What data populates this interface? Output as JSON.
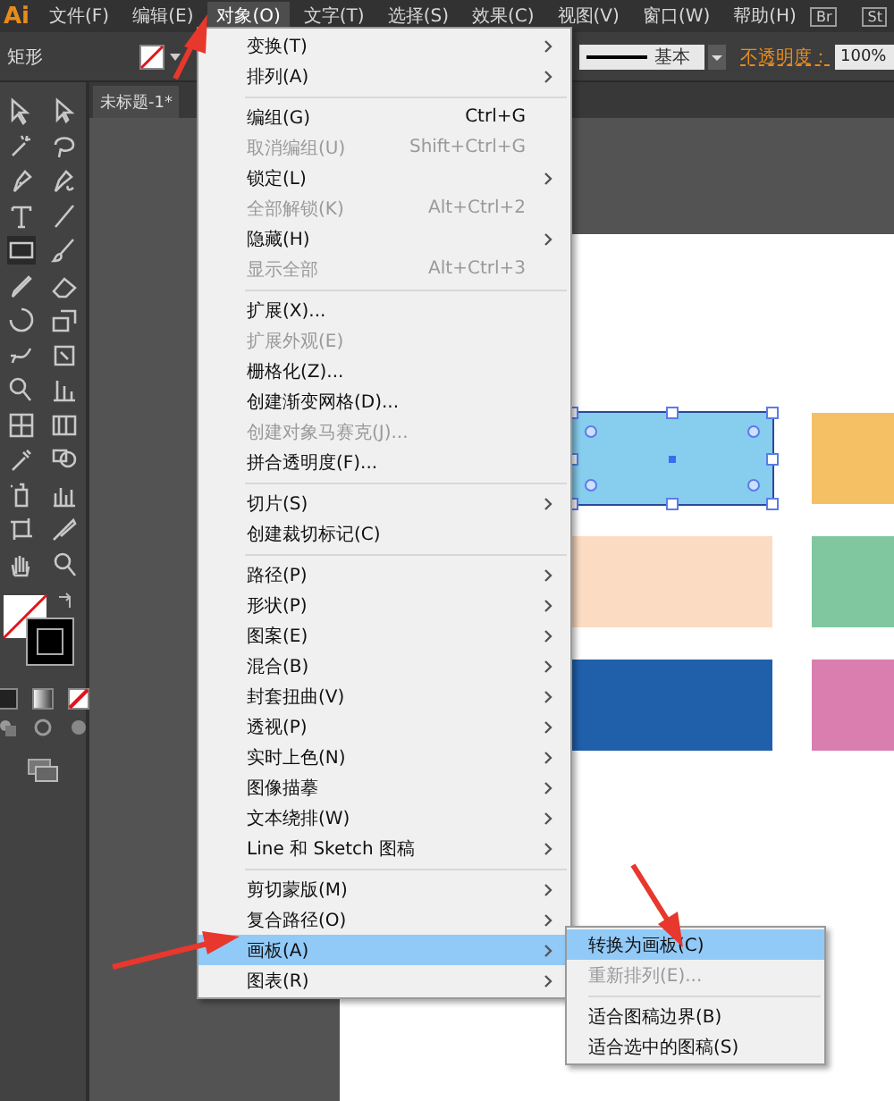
{
  "app_logo": "Ai",
  "menu_bar": [
    {
      "label": "文件(F)",
      "selected": false
    },
    {
      "label": "编辑(E)",
      "selected": false
    },
    {
      "label": "对象(O)",
      "selected": true
    },
    {
      "label": "文字(T)",
      "selected": false
    },
    {
      "label": "选择(S)",
      "selected": false
    },
    {
      "label": "效果(C)",
      "selected": false
    },
    {
      "label": "视图(V)",
      "selected": false
    },
    {
      "label": "窗口(W)",
      "selected": false
    },
    {
      "label": "帮助(H)",
      "selected": false
    }
  ],
  "bridge_buttons": [
    "Br",
    "St"
  ],
  "control_bar": {
    "tool_name": "矩形",
    "stroke_style": "基本",
    "opacity_label": "不透明度：",
    "opacity_value": "100%"
  },
  "document_tab": "未标题-1*",
  "artboard_shapes": [
    {
      "color": "#86cdee",
      "selected": true
    },
    {
      "color": "#f5c063",
      "selected": false
    },
    {
      "color": "#fbdcc3",
      "selected": false
    },
    {
      "color": "#80c7a0",
      "selected": false
    },
    {
      "color": "#2060ab",
      "selected": false
    },
    {
      "color": "#d97eae",
      "selected": false
    }
  ],
  "object_menu": [
    {
      "kind": "item",
      "label": "变换(T)",
      "submenu": true,
      "disabled": false,
      "selected": false
    },
    {
      "kind": "item",
      "label": "排列(A)",
      "submenu": true,
      "disabled": false,
      "selected": false
    },
    {
      "kind": "separator"
    },
    {
      "kind": "item",
      "label": "编组(G)",
      "shortcut": "Ctrl+G",
      "submenu": false,
      "disabled": false,
      "selected": false
    },
    {
      "kind": "item",
      "label": "取消编组(U)",
      "shortcut": "Shift+Ctrl+G",
      "submenu": false,
      "disabled": true,
      "selected": false
    },
    {
      "kind": "item",
      "label": "锁定(L)",
      "submenu": true,
      "disabled": false,
      "selected": false
    },
    {
      "kind": "item",
      "label": "全部解锁(K)",
      "shortcut": "Alt+Ctrl+2",
      "submenu": false,
      "disabled": true,
      "selected": false
    },
    {
      "kind": "item",
      "label": "隐藏(H)",
      "submenu": true,
      "disabled": false,
      "selected": false
    },
    {
      "kind": "item",
      "label": "显示全部",
      "shortcut": "Alt+Ctrl+3",
      "submenu": false,
      "disabled": true,
      "selected": false
    },
    {
      "kind": "separator"
    },
    {
      "kind": "item",
      "label": "扩展(X)...",
      "submenu": false,
      "disabled": false,
      "selected": false
    },
    {
      "kind": "item",
      "label": "扩展外观(E)",
      "submenu": false,
      "disabled": true,
      "selected": false
    },
    {
      "kind": "item",
      "label": "栅格化(Z)...",
      "submenu": false,
      "disabled": false,
      "selected": false
    },
    {
      "kind": "item",
      "label": "创建渐变网格(D)...",
      "submenu": false,
      "disabled": false,
      "selected": false
    },
    {
      "kind": "item",
      "label": "创建对象马赛克(J)...",
      "submenu": false,
      "disabled": true,
      "selected": false
    },
    {
      "kind": "item",
      "label": "拼合透明度(F)...",
      "submenu": false,
      "disabled": false,
      "selected": false
    },
    {
      "kind": "separator"
    },
    {
      "kind": "item",
      "label": "切片(S)",
      "submenu": true,
      "disabled": false,
      "selected": false
    },
    {
      "kind": "item",
      "label": "创建裁切标记(C)",
      "submenu": false,
      "disabled": false,
      "selected": false
    },
    {
      "kind": "separator"
    },
    {
      "kind": "item",
      "label": "路径(P)",
      "submenu": true,
      "disabled": false,
      "selected": false
    },
    {
      "kind": "item",
      "label": "形状(P)",
      "submenu": true,
      "disabled": false,
      "selected": false
    },
    {
      "kind": "item",
      "label": "图案(E)",
      "submenu": true,
      "disabled": false,
      "selected": false
    },
    {
      "kind": "item",
      "label": "混合(B)",
      "submenu": true,
      "disabled": false,
      "selected": false
    },
    {
      "kind": "item",
      "label": "封套扭曲(V)",
      "submenu": true,
      "disabled": false,
      "selected": false
    },
    {
      "kind": "item",
      "label": "透视(P)",
      "submenu": true,
      "disabled": false,
      "selected": false
    },
    {
      "kind": "item",
      "label": "实时上色(N)",
      "submenu": true,
      "disabled": false,
      "selected": false
    },
    {
      "kind": "item",
      "label": "图像描摹",
      "submenu": true,
      "disabled": false,
      "selected": false
    },
    {
      "kind": "item",
      "label": "文本绕排(W)",
      "submenu": true,
      "disabled": false,
      "selected": false
    },
    {
      "kind": "item",
      "label": "Line 和 Sketch 图稿",
      "submenu": true,
      "disabled": false,
      "selected": false
    },
    {
      "kind": "separator"
    },
    {
      "kind": "item",
      "label": "剪切蒙版(M)",
      "submenu": true,
      "disabled": false,
      "selected": false
    },
    {
      "kind": "item",
      "label": "复合路径(O)",
      "submenu": true,
      "disabled": false,
      "selected": false
    },
    {
      "kind": "item",
      "label": "画板(A)",
      "submenu": true,
      "disabled": false,
      "selected": true
    },
    {
      "kind": "item",
      "label": "图表(R)",
      "submenu": true,
      "disabled": false,
      "selected": false
    }
  ],
  "artboard_submenu": [
    {
      "kind": "item",
      "label": "转换为画板(C)",
      "disabled": false,
      "selected": true
    },
    {
      "kind": "item",
      "label": "重新排列(E)...",
      "disabled": true,
      "selected": false
    },
    {
      "kind": "separator"
    },
    {
      "kind": "item",
      "label": "适合图稿边界(B)",
      "disabled": false,
      "selected": false
    },
    {
      "kind": "item",
      "label": "适合选中的图稿(S)",
      "disabled": false,
      "selected": false
    }
  ]
}
